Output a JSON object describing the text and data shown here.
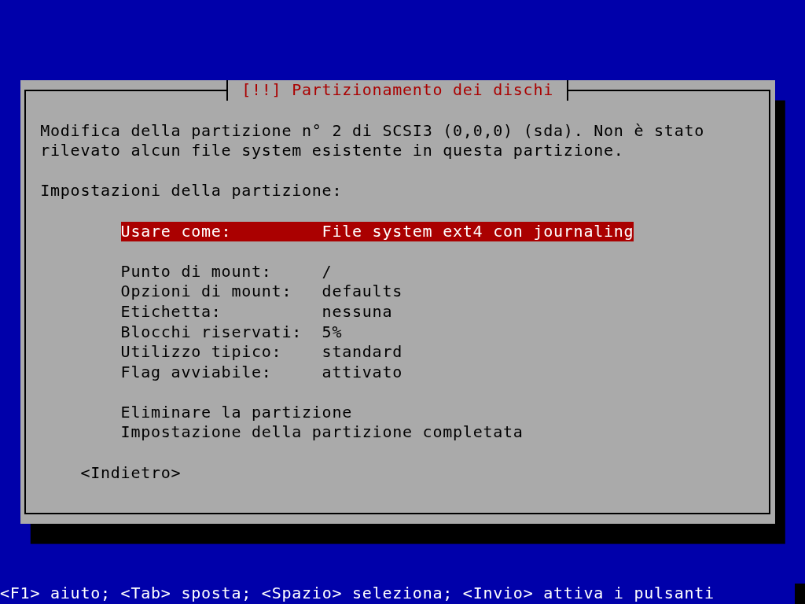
{
  "dialog": {
    "title": "[!!] Partizionamento dei dischi",
    "message": "Modifica della partizione n° 2 di SCSI3 (0,0,0) (sda). Non è stato rilevato alcun file system esistente in questa partizione.",
    "section_label": "Impostazioni della partizione:",
    "menu_groups": [
      {
        "items": [
          {
            "kind": "setting",
            "label": "Usare come:",
            "value": "File system ext4 con journaling",
            "selected": true
          }
        ]
      },
      {
        "items": [
          {
            "kind": "setting",
            "label": "Punto di mount:",
            "value": "/",
            "selected": false
          },
          {
            "kind": "setting",
            "label": "Opzioni di mount:",
            "value": "defaults",
            "selected": false
          },
          {
            "kind": "setting",
            "label": "Etichetta:",
            "value": "nessuna",
            "selected": false
          },
          {
            "kind": "setting",
            "label": "Blocchi riservati:",
            "value": "5%",
            "selected": false
          },
          {
            "kind": "setting",
            "label": "Utilizzo tipico:",
            "value": "standard",
            "selected": false
          },
          {
            "kind": "setting",
            "label": "Flag avviabile:",
            "value": "attivato",
            "selected": false
          }
        ]
      },
      {
        "items": [
          {
            "kind": "action",
            "label": "Eliminare la partizione",
            "selected": false
          },
          {
            "kind": "action",
            "label": "Impostazione della partizione completata",
            "selected": false
          }
        ]
      }
    ],
    "buttons": [
      "<Indietro>"
    ]
  },
  "help_line": "<F1> aiuto; <Tab> sposta; <Spazio> seleziona; <Invio> attiva i pulsanti"
}
